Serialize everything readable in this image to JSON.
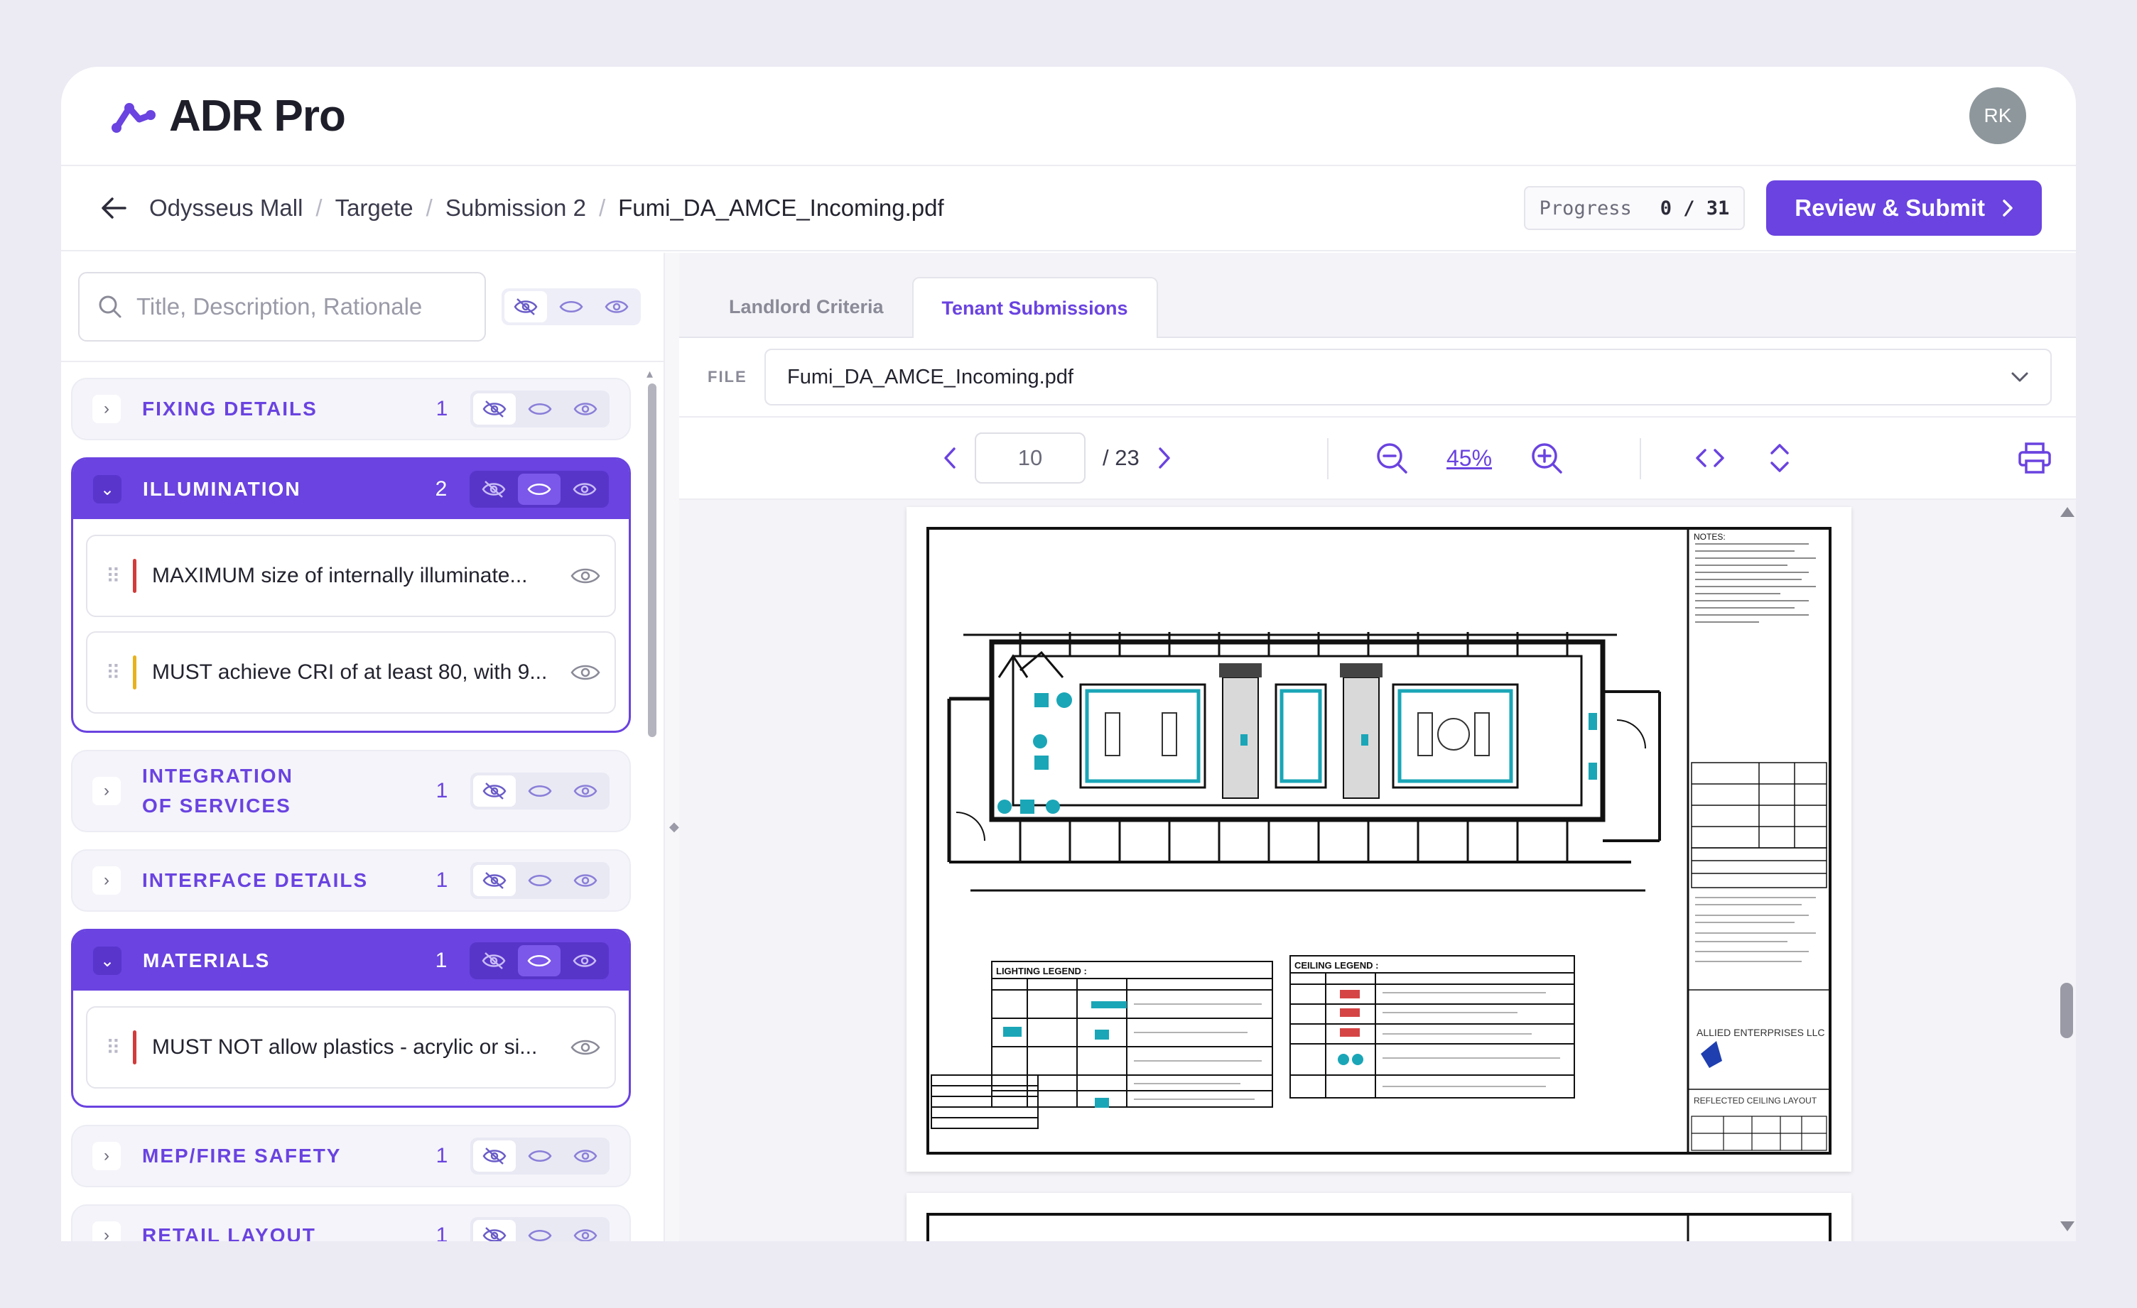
{
  "app": {
    "name": "ADR Pro",
    "user_initials": "RK"
  },
  "breadcrumb": {
    "items": [
      "Odysseus Mall",
      "Targete",
      "Submission 2",
      "Fumi_DA_AMCE_Incoming.pdf"
    ]
  },
  "progress": {
    "label": "Progress",
    "value": "0 / 31"
  },
  "submit_label": "Review & Submit",
  "search": {
    "placeholder": "Title, Description, Rationale"
  },
  "categories": [
    {
      "name": "FIXING DETAILS",
      "count": "1",
      "open": false
    },
    {
      "name": "ILLUMINATION",
      "count": "2",
      "open": true,
      "items": [
        {
          "text": "MAXIMUM size of internally illuminate...",
          "flag": "#d23b3b"
        },
        {
          "text": "MUST achieve CRI of at least 80, with 9...",
          "flag": "#e8b21e"
        }
      ]
    },
    {
      "name": "INTEGRATION OF SERVICES",
      "count": "1",
      "open": false
    },
    {
      "name": "INTERFACE DETAILS",
      "count": "1",
      "open": false
    },
    {
      "name": "MATERIALS",
      "count": "1",
      "open": true,
      "items": [
        {
          "text": "MUST NOT allow plastics - acrylic or si...",
          "flag": "#d23b3b"
        }
      ]
    },
    {
      "name": "MEP/FIRE SAFETY",
      "count": "1",
      "open": false
    },
    {
      "name": "RETAIL LAYOUT",
      "count": "1",
      "open": false
    }
  ],
  "tabs": [
    {
      "label": "Landlord Criteria",
      "active": false
    },
    {
      "label": "Tenant Submissions",
      "active": true
    }
  ],
  "file": {
    "label": "FILE",
    "selected": "Fumi_DA_AMCE_Incoming.pdf"
  },
  "viewer": {
    "page": "10",
    "total": "/ 23",
    "zoom": "45%"
  },
  "drawing": {
    "legend_lighting": "LIGHTING LEGEND :",
    "legend_ceiling": "CEILING LEGEND :",
    "company": "ALLIED ENTERPRISES LLC",
    "sheet_title": "REFLECTED CEILING LAYOUT",
    "notes": "NOTES:"
  },
  "colors": {
    "accent": "#6a43e0",
    "flag_red": "#d23b3b",
    "flag_yellow": "#e8b21e",
    "drawing_teal": "#1aa6b7"
  }
}
